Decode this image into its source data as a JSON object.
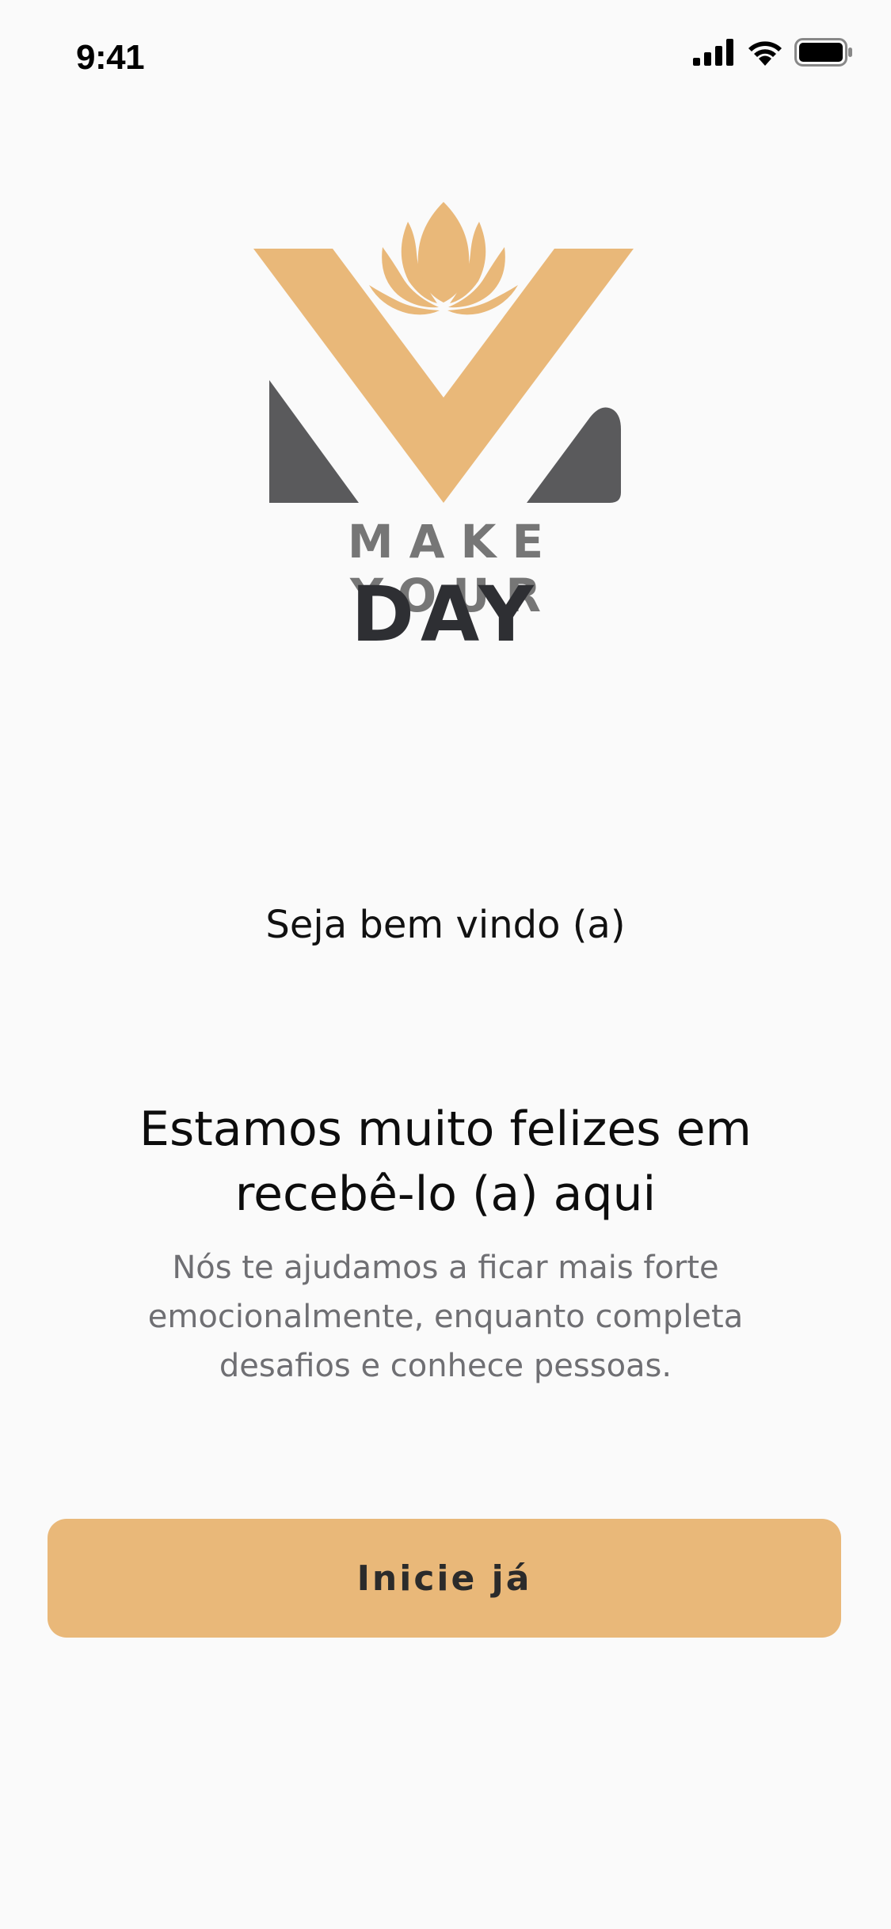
{
  "status_bar": {
    "time": "9:41",
    "icons": [
      "cellular-signal-icon",
      "wifi-icon",
      "battery-icon"
    ]
  },
  "logo": {
    "line1": "MAKE YOUR",
    "line2": "DAY"
  },
  "welcome": "Seja bem vindo (a)",
  "headline": "Estamos muito felizes em recebê-lo (a) aqui",
  "subtext": "Nós te ajudamos a ficar mais forte emocionalmente, enquanto completa desafios e conhece pessoas.",
  "cta": {
    "label": "Inicie já"
  },
  "colors": {
    "accent": "#e9b879",
    "logo_dark": "#5a5a5c",
    "logo_text_gray": "#767676",
    "logo_text_dark": "#2e2f33",
    "background": "#fafafa",
    "subtext": "#6f6f73"
  }
}
